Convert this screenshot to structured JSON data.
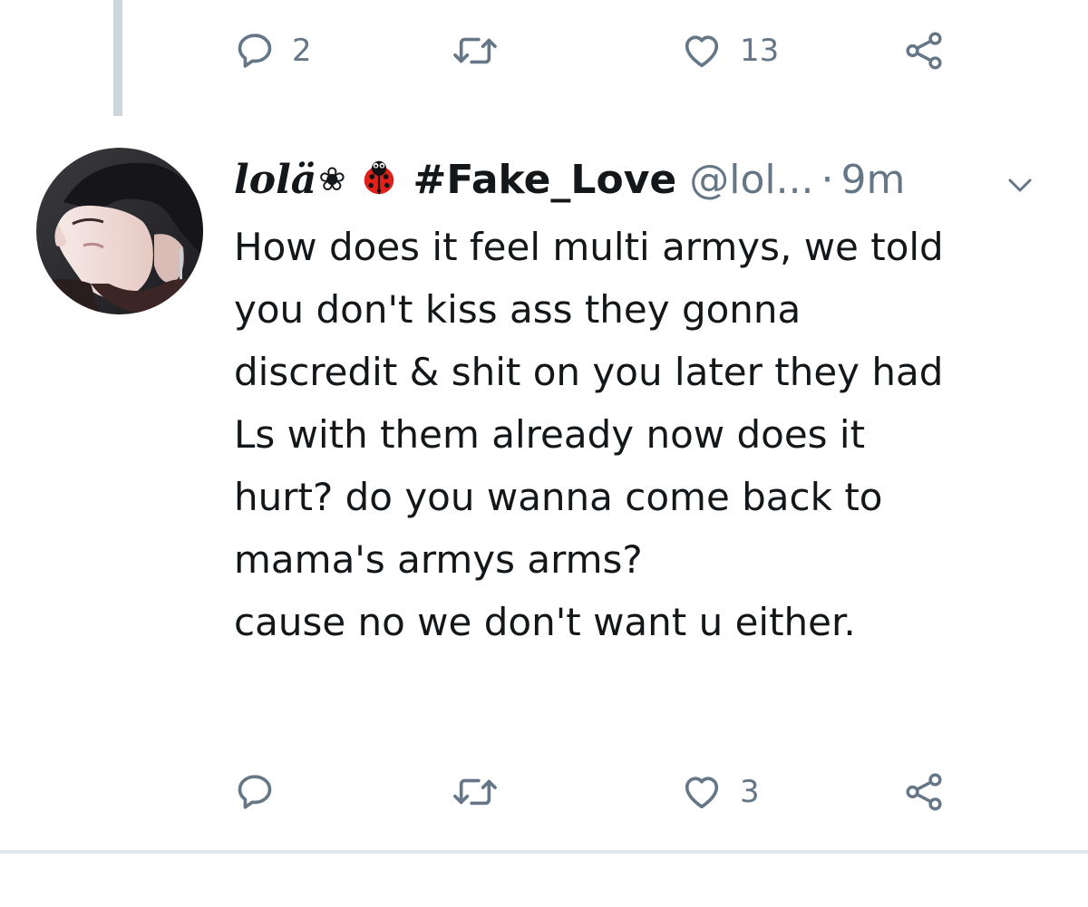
{
  "colors": {
    "text_primary": "#14171a",
    "text_secondary": "#657786",
    "thread_line": "#ccd6dd",
    "divider": "#e1e8ed"
  },
  "previous_tweet": {
    "actions": {
      "reply_icon": "reply-bubble-icon",
      "reply_count": "2",
      "retweet_icon": "retweet-arrows-icon",
      "like_icon": "heart-icon",
      "like_count": "13",
      "share_icon": "share-nodes-icon"
    }
  },
  "tweet": {
    "author": {
      "display_name": "lolä",
      "name_symbol": "❀",
      "name_emoji": "ladybug-emoji",
      "name_hashtag": "#Fake_Love",
      "handle": "@lol...",
      "separator": "·",
      "timestamp": "9m"
    },
    "text_lines": [
      "How does it feel multi armys, we told",
      "you don't kiss ass they gonna",
      "discredit & shit on you later they had",
      "Ls with them already now does it",
      "hurt? do you wanna come back to",
      "mama's armys arms?",
      "",
      "cause no we don't want u either."
    ],
    "actions": {
      "reply_count": "",
      "like_count": "3"
    }
  }
}
